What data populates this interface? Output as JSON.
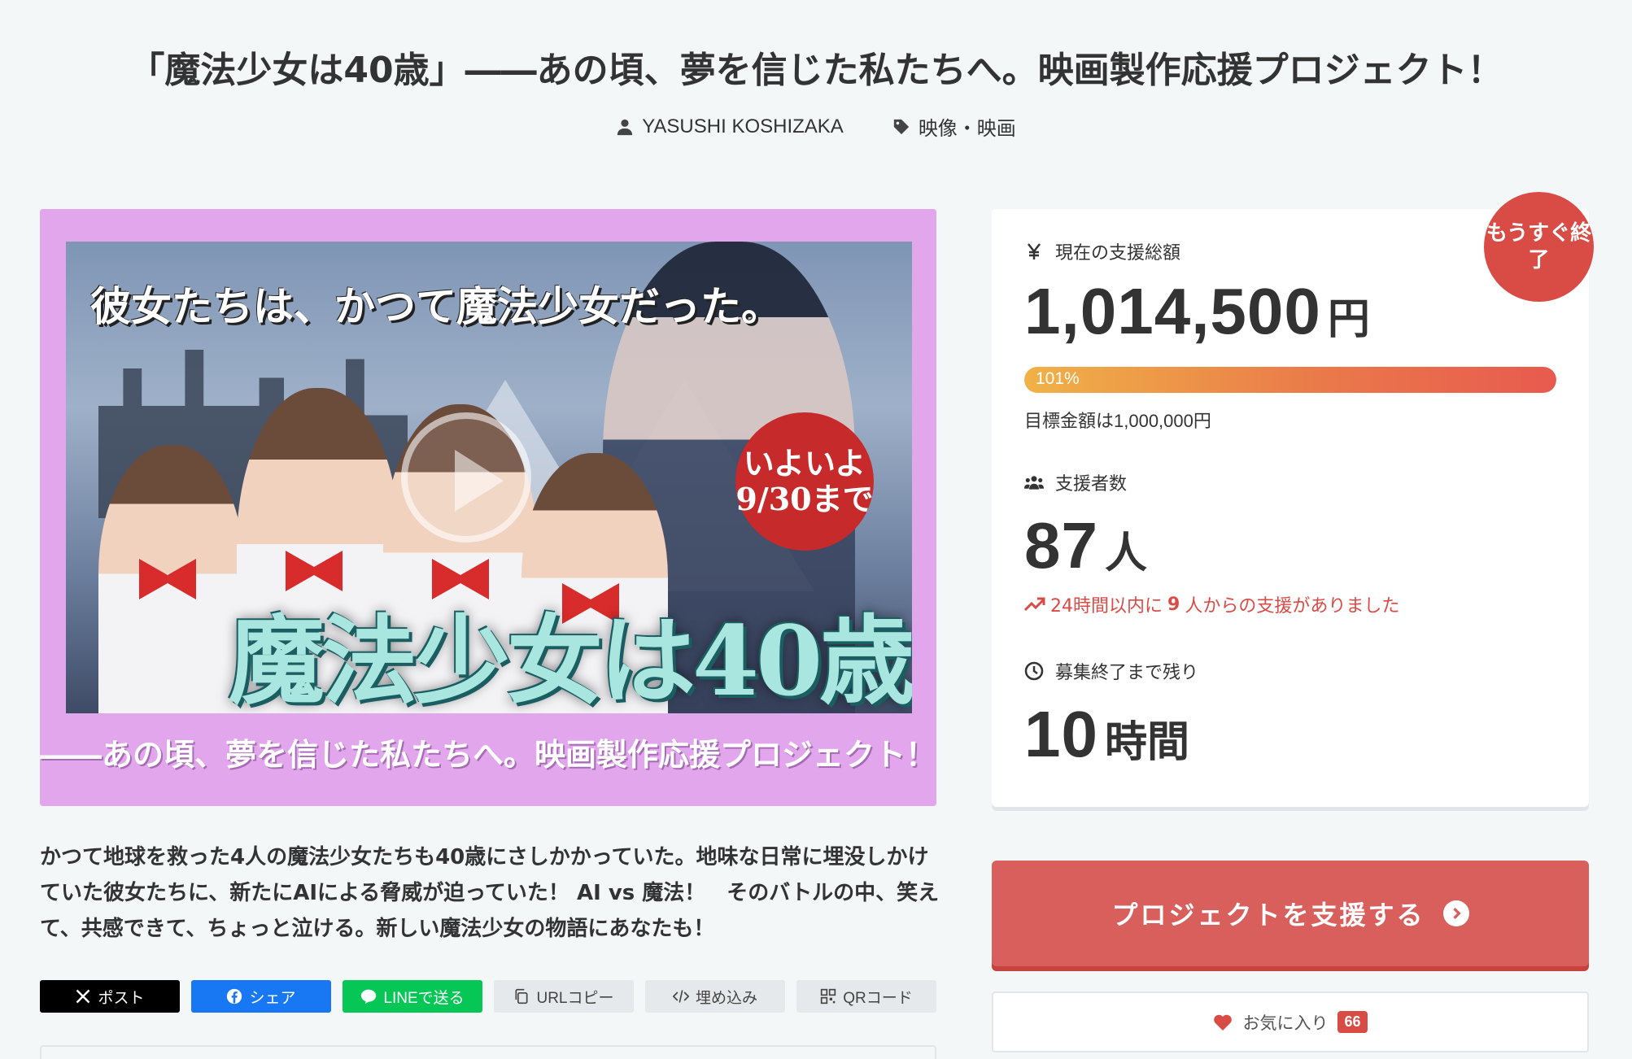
{
  "title": "「魔法少女は40歳」――あの頃、夢を信じた私たちへ。映画製作応援プロジェクト！",
  "meta": {
    "author": "YASUSHI KOSHIZAKA",
    "category": "映像・映画"
  },
  "hero": {
    "tagline": "彼女たちは、かつて魔法少女だった。",
    "badge_line1": "いよいよ",
    "badge_line2": "9/30まで",
    "big_title": "魔法少女は40歳",
    "subtitle": "――あの頃、夢を信じた私たちへ。映画製作応援プロジェクト！"
  },
  "description": "かつて地球を救った4人の魔法少女たちも40歳にさしかかっていた。地味な日常に埋没しかけていた彼女たちに、新たにAIによる脅威が迫っていた！ AI vs 魔法！　そのバトルの中、笑えて、共感できて、ちょっと泣ける。新しい魔法少女の物語にあなたも！",
  "share": {
    "x": "ポスト",
    "facebook": "シェア",
    "line": "LINEで送る",
    "url": "URLコピー",
    "embed": "埋め込み",
    "qr": "QRコード"
  },
  "stats": {
    "ending_badge": "もうすぐ終了",
    "total_label": "現在の支援総額",
    "total_value": "1,014,500",
    "total_unit": "円",
    "progress_label": "101%",
    "progress_fraction": 1.0,
    "target_text": "目標金額は1,000,000円",
    "supporters_label": "支援者数",
    "supporters_value": "87",
    "supporters_unit": "人",
    "trend_prefix": "24時間以内に",
    "trend_count": "9",
    "trend_suffix": "人からの支援がありました",
    "remaining_label": "募集終了まで残り",
    "remaining_value": "10",
    "remaining_unit": "時間"
  },
  "actions": {
    "support": "プロジェクトを支援する",
    "favorite": "お気に入り",
    "favorite_count": "66"
  },
  "colors": {
    "accent_red": "#d94b45",
    "button_red": "#d95f5d",
    "hero_frame": "#e2a6ec",
    "line_green": "#06c755",
    "facebook_blue": "#1877f2"
  }
}
